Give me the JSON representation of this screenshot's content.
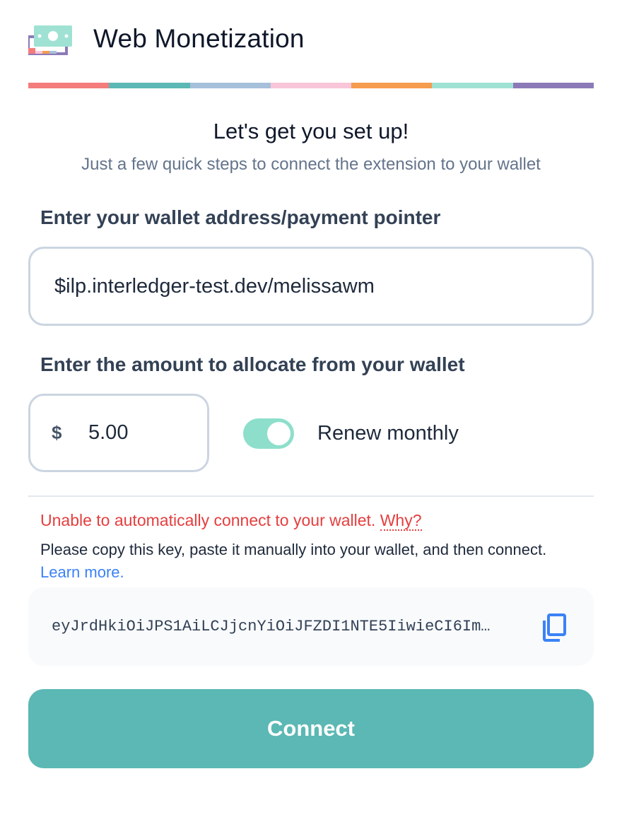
{
  "header": {
    "title": "Web Monetization",
    "logo_icon": "money-bill-icon"
  },
  "rainbow_colors": [
    "#f47c7c",
    "#5bb8b4",
    "#a6c0dc",
    "#f9c6d9",
    "#f59c4e",
    "#9fe2d3",
    "#8c7ab8"
  ],
  "intro": {
    "heading": "Let's get you set up!",
    "subheading": "Just a few quick steps to connect the extension to your wallet"
  },
  "wallet": {
    "label": "Enter your wallet address/payment pointer",
    "value": "$ilp.interledger-test.dev/melissawm"
  },
  "amount": {
    "label": "Enter the amount to allocate from your wallet",
    "currency_symbol": "$",
    "value": "5.00",
    "renew_label": "Renew monthly",
    "renew_enabled": true
  },
  "error": {
    "message": "Unable to automatically connect to your wallet.",
    "why_link": "Why?",
    "info_text": "Please copy this key, paste it manually into your wallet, and then connect.",
    "learn_more_link": "Learn more."
  },
  "key": {
    "value": "eyJrdHkiOiJPS1AiLCJjcnYiOiJFZDI1NTE5IiwieCI6Im…",
    "copy_icon": "copy-icon"
  },
  "actions": {
    "connect_label": "Connect"
  },
  "colors": {
    "accent": "#5bb8b4",
    "toggle_on": "#8ddfcb",
    "error": "#e53e3e",
    "link": "#3b82f6"
  }
}
